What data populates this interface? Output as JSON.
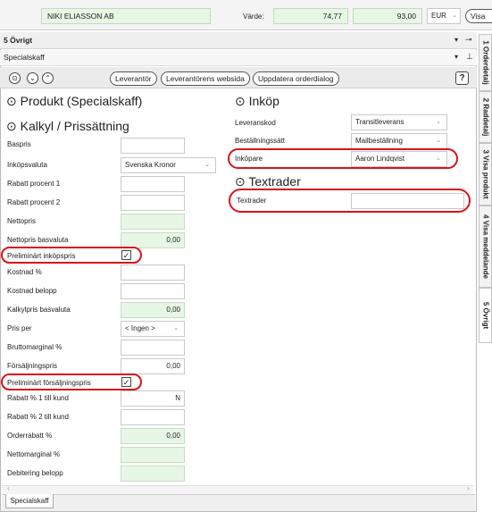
{
  "topbar": {
    "company": "NIKI ELIASSON AB",
    "value_label": "Värde:",
    "value_1": "74,77",
    "value_2": "93,00",
    "currency": "EUR",
    "visa_button": "Visa"
  },
  "section": {
    "title": "5 Övrigt",
    "pin_icon": "pin-icon",
    "dropdown_icon": "chevron-down-icon"
  },
  "subsection": {
    "title": "Specialskaff"
  },
  "toolbar": {
    "leverantor": "Leverantör",
    "leverantor_webbsida": "Leverantörens websida",
    "uppdatera": "Uppdatera orderdialog",
    "help": "?"
  },
  "produkt": {
    "title": "Produkt (Specialskaff)"
  },
  "kalkyl": {
    "title": "Kalkyl / Prissättning",
    "rows": {
      "baspris": {
        "label": "Baspris",
        "value": ""
      },
      "inkopsvaluta": {
        "label": "Inköpsvaluta",
        "value": "Svenska Kronor"
      },
      "rabatt1": {
        "label": "Rabatt procent 1",
        "value": ""
      },
      "rabatt2": {
        "label": "Rabatt procent 2",
        "value": ""
      },
      "nettopris": {
        "label": "Nettopris",
        "value": ""
      },
      "nettopris_bas": {
        "label": "Nettopris basvaluta",
        "value": "0,00"
      },
      "prelim_inkop": {
        "label": "Preliminärt inköpspris",
        "checked": "✓"
      },
      "kostnad_pct": {
        "label": "Kostnad %",
        "value": ""
      },
      "kostnad_belopp": {
        "label": "Kostnad belopp",
        "value": ""
      },
      "kalkylpris": {
        "label": "Kalkylpris basvaluta",
        "value": "0,00"
      },
      "pris_per": {
        "label": "Pris per",
        "value": "< Ingen >"
      },
      "bruttomarginal": {
        "label": "Bruttomarginal %",
        "value": ""
      },
      "forsaljningspris": {
        "label": "Försäljningspris",
        "value": "0,00"
      },
      "prelim_forsalj": {
        "label": "Preliminärt försäljningspris",
        "checked": "✓"
      },
      "rabatt_kund1": {
        "label": "Rabatt % 1 till kund",
        "value": "N"
      },
      "rabatt_kund2": {
        "label": "Rabatt % 2 till kund",
        "value": ""
      },
      "orderrabatt": {
        "label": "Orderrabatt %",
        "value": "0,00"
      },
      "nettomarginal": {
        "label": "Nettomarginal %",
        "value": ""
      },
      "debitering": {
        "label": "Debitering belopp",
        "value": ""
      }
    }
  },
  "inkop": {
    "title": "Inköp",
    "leveranskod": {
      "label": "Leveranskod",
      "value": "Transitleverans"
    },
    "bestallningssatt": {
      "label": "Beställningssätt",
      "value": "Mailbeställning"
    },
    "inkopare": {
      "label": "Inköpare",
      "value": "Aaron Lindqvist"
    }
  },
  "textrader": {
    "title": "Textrader",
    "label": "Textrader",
    "value": ""
  },
  "bottom_tab": "Specialskaff",
  "side_tabs": [
    "1 Orderdetalj",
    "2 Raddetalj",
    "3 Visa produkt",
    "4 Visa meddelande",
    "5 Övrigt"
  ],
  "colors": {
    "highlight_ring": "#d8141a",
    "readonly_green": "#e7f7e5"
  }
}
